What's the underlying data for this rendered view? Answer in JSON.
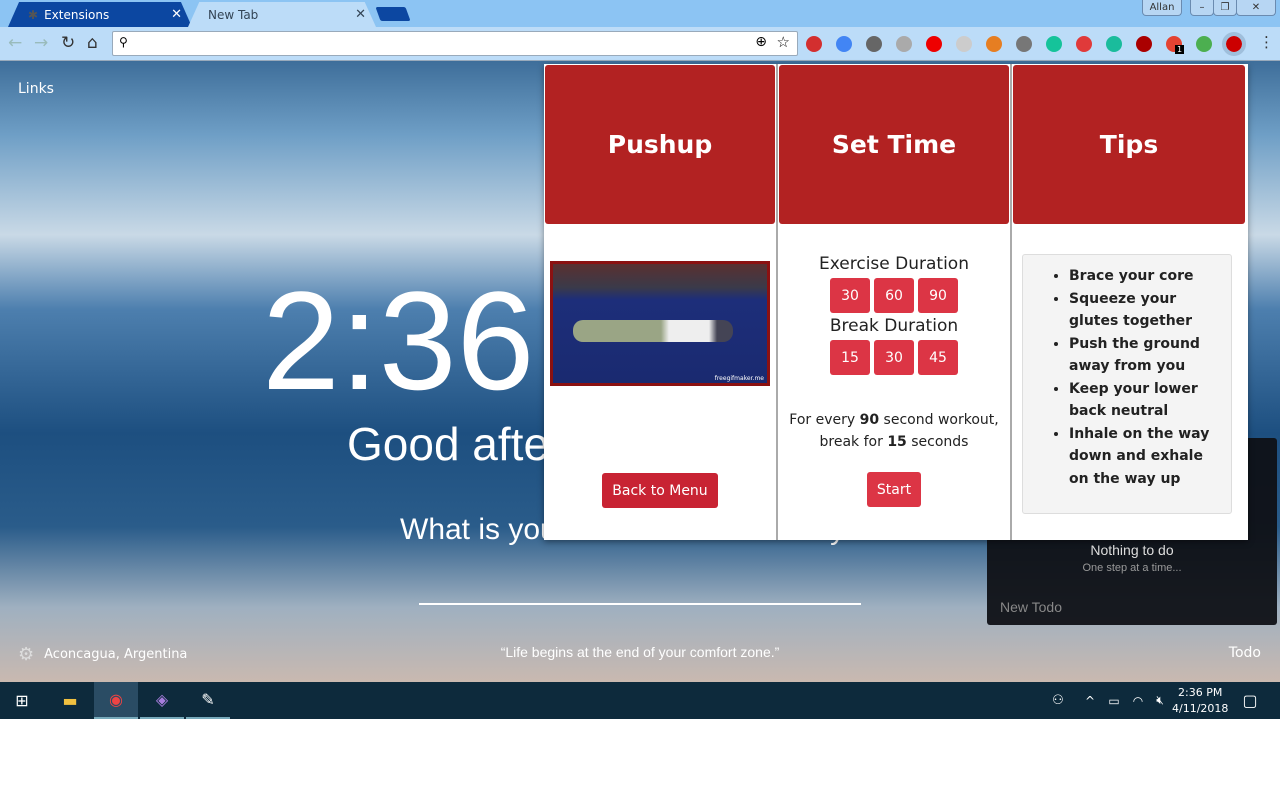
{
  "browser": {
    "tabs": [
      {
        "label": "Extensions",
        "icon": "puzzle-icon"
      },
      {
        "label": "New Tab"
      }
    ],
    "profile": "Allan",
    "address": "",
    "extensions": [
      {
        "icon": "book-icon",
        "color": "#d32f2f"
      },
      {
        "icon": "translate-icon",
        "color": "#4285f4"
      },
      {
        "icon": "ublock-icon",
        "color": "#666"
      },
      {
        "icon": "css-icon",
        "color": "#aaa"
      },
      {
        "icon": "opera-stop-icon",
        "color": "#e00"
      },
      {
        "icon": "shield-icon",
        "color": "#ccc"
      },
      {
        "icon": "basketball-icon",
        "color": "#e67e22"
      },
      {
        "icon": "office-icon",
        "color": "#777"
      },
      {
        "icon": "grammarly-icon",
        "color": "#15c39a"
      },
      {
        "icon": "record-icon",
        "color": "#e03a3a"
      },
      {
        "icon": "m-icon",
        "color": "#1abc9c"
      },
      {
        "icon": "plus-shield-icon",
        "color": "#a00"
      },
      {
        "icon": "todoist-icon",
        "color": "#e44332",
        "badge": "1"
      },
      {
        "icon": "compass-icon",
        "color": "#4caf50"
      },
      {
        "icon": "rm-icon",
        "color": "#c00"
      }
    ]
  },
  "newtab": {
    "links": "Links",
    "clock": "2:36",
    "greeting": "Good afternoon",
    "focus_prompt": "What is your main focus for today?",
    "location": "Aconcagua, Argentina",
    "quote": "“Life begins at the end of your comfort zone.”",
    "todo_label": "Todo",
    "todo": {
      "empty": "Nothing to do",
      "sub": "One step at a time...",
      "new": "New Todo"
    }
  },
  "popup": {
    "accent": "#b22222",
    "exercise": {
      "title": "Pushup",
      "image_watermark": "freegifmaker.me",
      "back": "Back to Menu"
    },
    "settime": {
      "title": "Set Time",
      "exercise_label": "Exercise Duration",
      "exercise_options": [
        "30",
        "60",
        "90"
      ],
      "break_label": "Break Duration",
      "break_options": [
        "15",
        "30",
        "45"
      ],
      "summary_pre": "For every ",
      "selected_exercise": "90",
      "summary_mid": " second workout,",
      "summary_break_pre": "break for ",
      "selected_break": "15",
      "summary_post": " seconds",
      "start": "Start"
    },
    "tips": {
      "title": "Tips",
      "items": [
        "Brace your core",
        "Squeeze your glutes together",
        "Push the ground away from you",
        "Keep your lower back neutral",
        "Inhale on the way down and exhale on the way up"
      ]
    }
  },
  "taskbar": {
    "time": "2:36 PM",
    "date": "4/11/2018"
  }
}
